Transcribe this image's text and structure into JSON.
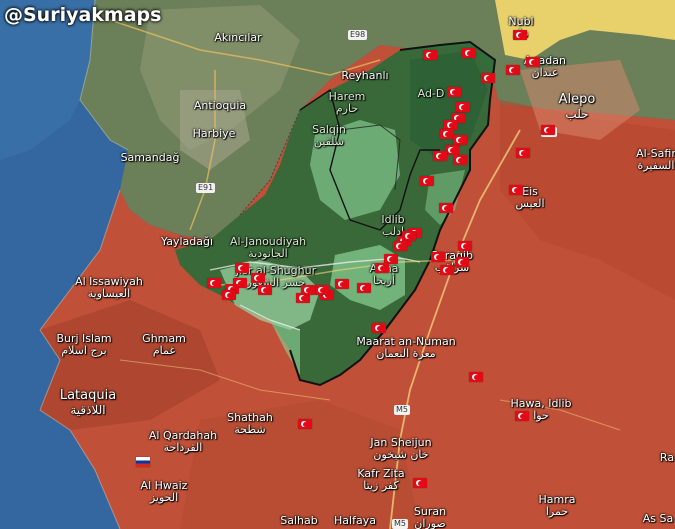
{
  "watermark": "@Suriyakmaps",
  "colors": {
    "sea": "#3a6ea5",
    "government": "#c0503a",
    "opposition": "#2f6b3a",
    "opposition_light": "#8fd39a",
    "kurdish": "#f4e27a",
    "turkey": "#5a7a4a",
    "turkish_flag": "#e30a17"
  },
  "highways": [
    "E98",
    "E91",
    "M5",
    "M5",
    "M5"
  ],
  "cities": [
    {
      "id": "nubl",
      "name": "Nubl",
      "ar": "نبل"
    },
    {
      "id": "anadan",
      "name": "Anadan",
      "ar": "عندان"
    },
    {
      "id": "akincilar",
      "name": "Akıncılar",
      "ar": ""
    },
    {
      "id": "reyhanli",
      "name": "Reyhanlı",
      "ar": ""
    },
    {
      "id": "harem",
      "name": "Harem",
      "ar": "حارم"
    },
    {
      "id": "addana",
      "name": "Ad-D",
      "ar": ""
    },
    {
      "id": "aleppo",
      "name": "Alepo",
      "ar": "حلب"
    },
    {
      "id": "antioquia",
      "name": "Antioquia",
      "ar": ""
    },
    {
      "id": "harbiye",
      "name": "Harbiye",
      "ar": ""
    },
    {
      "id": "salqin",
      "name": "Salqin",
      "ar": "سلقين"
    },
    {
      "id": "samandag",
      "name": "Samandağ",
      "ar": ""
    },
    {
      "id": "alsafira",
      "name": "Al-Safir",
      "ar": "السفيرة"
    },
    {
      "id": "eis",
      "name": "Eis",
      "ar": "العيس"
    },
    {
      "id": "yayladagi",
      "name": "Yayladağı",
      "ar": ""
    },
    {
      "id": "aljanoudiyah",
      "name": "Al-Janoudiyah",
      "ar": "الجانودية"
    },
    {
      "id": "idlib",
      "name": "Idlib",
      "ar": "ادلب"
    },
    {
      "id": "saraqib",
      "name": "Saraqib",
      "ar": "سراقب"
    },
    {
      "id": "alshughur",
      "name": "Jisr al-Shughur",
      "ar": "جسر الشغور"
    },
    {
      "id": "ariha",
      "name": "Ariha",
      "ar": "أريحا"
    },
    {
      "id": "alissawiyah",
      "name": "Al Issawiyah",
      "ar": "العيساوية"
    },
    {
      "id": "burjislam",
      "name": "Burj Islam",
      "ar": "برج اسلام"
    },
    {
      "id": "ghmam",
      "name": "Ghmam",
      "ar": "غمام"
    },
    {
      "id": "maaratannuman",
      "name": "Maarat an-Numan",
      "ar": "معرة النعمان"
    },
    {
      "id": "lataquia",
      "name": "Lataquia",
      "ar": "اللاذقية"
    },
    {
      "id": "hawaidlib",
      "name": "Hawa, Idlib",
      "ar": "حوا"
    },
    {
      "id": "shathah",
      "name": "Shathah",
      "ar": "شطحة"
    },
    {
      "id": "alqardahah",
      "name": "Al Qardahah",
      "ar": "القرداحة"
    },
    {
      "id": "jansheijun",
      "name": "Jan Sheijun",
      "ar": "خان شيخون"
    },
    {
      "id": "kafrzita",
      "name": "Kafr Zita",
      "ar": "كفر زيتا"
    },
    {
      "id": "alhwaiz",
      "name": "Al Hwaiz",
      "ar": "الحويز"
    },
    {
      "id": "hamra",
      "name": "Hamra",
      "ar": "حمرا"
    },
    {
      "id": "salhab",
      "name": "Salhab",
      "ar": ""
    },
    {
      "id": "halfaya",
      "name": "Halfaya",
      "ar": ""
    },
    {
      "id": "suran",
      "name": "Suran",
      "ar": "صوران"
    },
    {
      "id": "assa",
      "name": "As Sa",
      "ar": ""
    },
    {
      "id": "ra",
      "name": "Ra",
      "ar": ""
    }
  ],
  "markers": {
    "turkish_posts": 48,
    "russian_posts": 1
  }
}
